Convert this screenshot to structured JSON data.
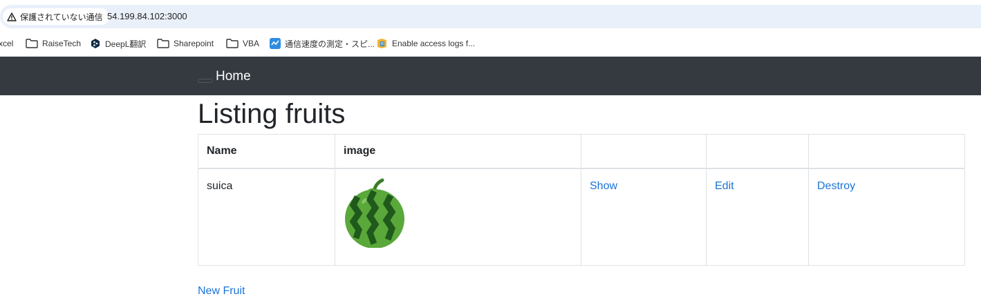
{
  "browser": {
    "security_label": "保護されていない通信",
    "url": "54.199.84.102:3000"
  },
  "bookmarks": [
    {
      "label": "xcel",
      "icon": "cut-off-bookmark"
    },
    {
      "label": "RaiseTech",
      "icon": "folder-icon"
    },
    {
      "label": "DeepL翻訳",
      "icon": "deepl-icon"
    },
    {
      "label": "Sharepoint",
      "icon": "folder-icon"
    },
    {
      "label": "VBA",
      "icon": "folder-icon"
    },
    {
      "label": "通信速度の測定・スピ...",
      "icon": "speedtest-icon"
    },
    {
      "label": "Enable access logs f...",
      "icon": "aws-docs-icon"
    }
  ],
  "navbar": {
    "brand": "Home",
    "background": "#343a40"
  },
  "main": {
    "title": "Listing fruits",
    "table": {
      "headers": [
        "Name",
        "image",
        "",
        "",
        ""
      ],
      "rows": [
        {
          "name": "suica",
          "image": "watermelon-image",
          "show": "Show",
          "edit": "Edit",
          "destroy": "Destroy"
        }
      ]
    },
    "new_link": "New Fruit"
  },
  "colors": {
    "link": "#1a73d9",
    "text": "#212529",
    "border": "#dee2e6",
    "address_bar": "#eaf0fa"
  }
}
